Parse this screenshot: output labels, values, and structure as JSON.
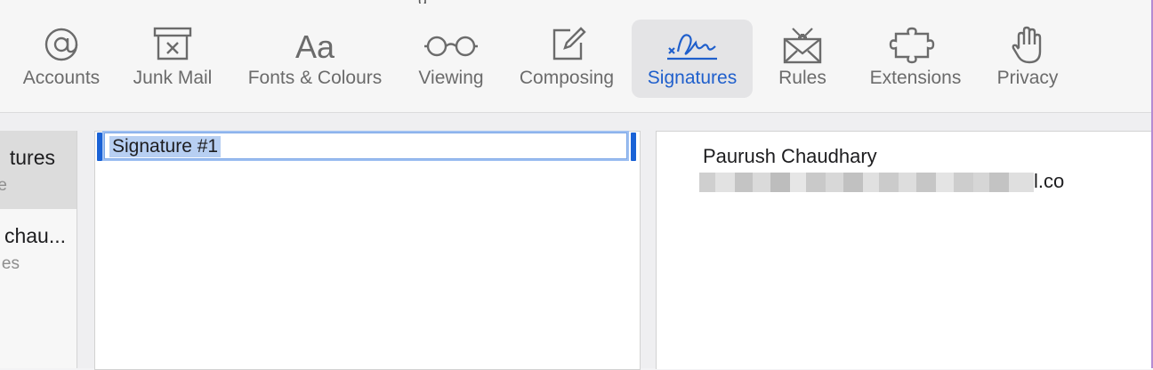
{
  "window": {
    "title_partial": "g"
  },
  "toolbar": {
    "tabs": [
      {
        "label": "Accounts",
        "icon": "at-sign-icon"
      },
      {
        "label": "Junk Mail",
        "icon": "junk-tray-icon"
      },
      {
        "label": "Fonts & Colours",
        "icon": "font-aa-icon"
      },
      {
        "label": "Viewing",
        "icon": "glasses-icon"
      },
      {
        "label": "Composing",
        "icon": "compose-pencil-icon"
      },
      {
        "label": "Signatures",
        "icon": "signature-icon",
        "active": true
      },
      {
        "label": "Rules",
        "icon": "envelope-rules-icon"
      },
      {
        "label": "Extensions",
        "icon": "puzzle-icon"
      },
      {
        "label": "Privacy",
        "icon": "hand-icon"
      }
    ]
  },
  "accounts_list": {
    "items": [
      {
        "name": "tures",
        "subtitle": "e",
        "selected": true
      },
      {
        "name": "chau...",
        "subtitle": "es",
        "selected": false
      }
    ]
  },
  "signatures_list": {
    "items": [
      {
        "name": "Signature #1",
        "selected": true
      }
    ]
  },
  "signature_editor": {
    "name_line": "Paurush Chaudhary",
    "email_visible_suffix": "l.co"
  },
  "colors": {
    "accent": "#1f5fcc",
    "selection_bar": "#1a62d6",
    "toolbar_active_bg": "#e4e4e6"
  }
}
